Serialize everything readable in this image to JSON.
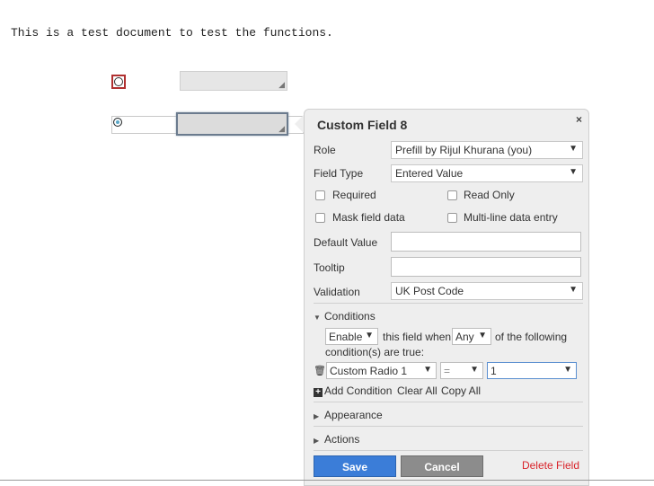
{
  "document": {
    "text": "This is a test document to test the functions."
  },
  "panel": {
    "title": "Custom Field 8",
    "close_icon": "×",
    "role": {
      "label": "Role",
      "value": "Prefill by Rijul Khurana (you)"
    },
    "field_type": {
      "label": "Field Type",
      "value": "Entered Value"
    },
    "checkboxes": {
      "required": "Required",
      "read_only": "Read Only",
      "mask": "Mask field data",
      "multiline": "Multi-line data entry"
    },
    "default_value": {
      "label": "Default Value",
      "value": ""
    },
    "tooltip": {
      "label": "Tooltip",
      "value": ""
    },
    "validation": {
      "label": "Validation",
      "value": "UK Post Code"
    },
    "conditions": {
      "header": "Conditions",
      "action": "Enable",
      "text1": "this field when",
      "quantifier": "Any",
      "text2": "of the following",
      "text3": "condition(s) are true:",
      "rule": {
        "field": "Custom Radio 1",
        "operator": "=",
        "value": "1"
      },
      "add": "Add Condition",
      "clear": "Clear All",
      "copy": "Copy All"
    },
    "appearance": "Appearance",
    "actions": "Actions",
    "buttons": {
      "save": "Save",
      "cancel": "Cancel",
      "delete": "Delete Field"
    }
  },
  "icons": {
    "caret": "▼",
    "expanded": "▼",
    "collapsed": "▶",
    "trash": "🗑",
    "plus": "+"
  },
  "colors": {
    "save": "#3b7dd8",
    "cancel": "#8c8c8c",
    "delete": "#d9242b",
    "radio_border": "#b03030"
  }
}
